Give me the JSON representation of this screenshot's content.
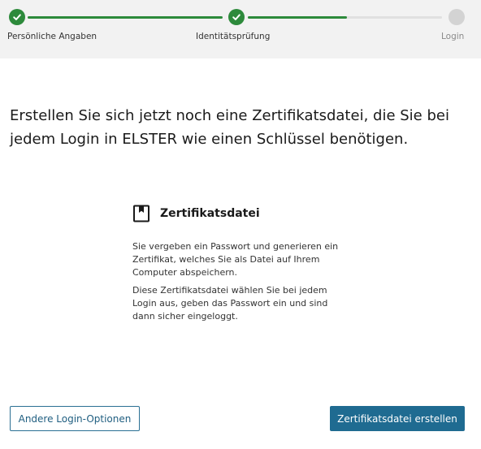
{
  "stepper": {
    "steps": [
      {
        "label": "Persönliche Angaben",
        "status": "done"
      },
      {
        "label": "Identitätsprüfung",
        "status": "done"
      },
      {
        "label": "Login",
        "status": "pending"
      }
    ],
    "progress_in_last_segment": 0.5,
    "colors": {
      "done": "#2d8a3b",
      "pending": "#d3d3d3",
      "track": "#e0e0e0"
    }
  },
  "main": {
    "headline": "Erstellen Sie sich jetzt noch eine Zertifikatsdatei, die Sie bei jedem Login in ELSTER wie einen Schlüssel benötigen."
  },
  "card": {
    "icon": "bookmark-document-icon",
    "title": "Zertifikatsdatei",
    "paragraph1": "Sie vergeben ein Passwort und generieren ein Zertifikat, welches Sie als Datei auf Ihrem Computer abspeichern.",
    "paragraph2": "Diese Zertifikatsdatei wählen Sie bei jedem Login aus, geben das Passwort ein und sind dann sicher eingeloggt."
  },
  "actions": {
    "secondary_label": "Andere Login-Optionen",
    "primary_label": "Zertifikatsdatei erstellen",
    "primary_color": "#1f6b91"
  }
}
